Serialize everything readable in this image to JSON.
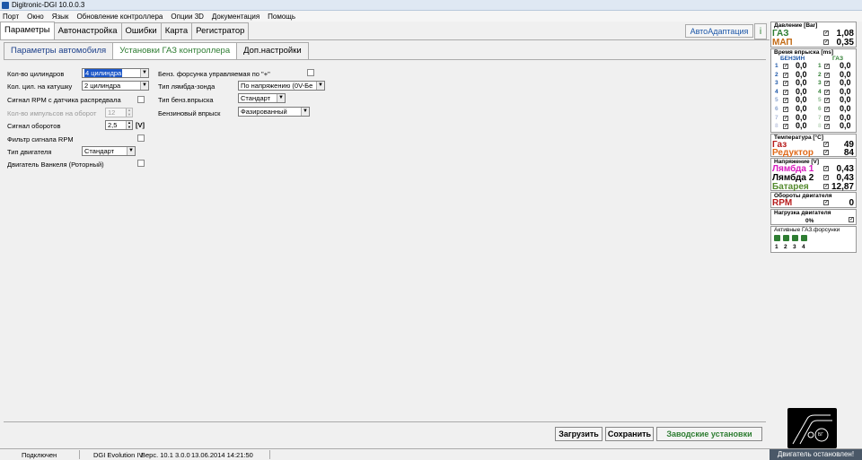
{
  "window": {
    "title": "Digitronic-DGI  10.0.0.3"
  },
  "menu": [
    "Порт",
    "Окно",
    "Язык",
    "Обновление контроллера",
    "Опции 3D",
    "Документация",
    "Помощь"
  ],
  "main_tabs": [
    "Параметры",
    "Автонастройка",
    "Ошибки",
    "Карта",
    "Регистратор"
  ],
  "auto_adapt": "АвтоАдаптация",
  "info_icon": "info-icon",
  "sub_tabs": [
    "Параметры автомобиля",
    "Установки ГАЗ контроллера",
    "Доп.настройки"
  ],
  "left_col": {
    "cyl_label": "Кол-во цилиндров",
    "cyl_value": "4 цилиндра",
    "coil_label": "Кол. цил. на катушку",
    "coil_value": "2 цилиндра",
    "rpm_sensor_label": "Сигнал RPM с датчика распредвала",
    "pulses_label": "Кол-во импульсов на оборот",
    "pulses_value": "12",
    "rpm_signal_label": "Сигнал оборотов",
    "rpm_signal_value": "2,5",
    "rpm_signal_unit": "[V]",
    "rpm_filter_label": "Фильтр сигнала RPM",
    "engine_type_label": "Тип двигателя",
    "engine_type_value": "Стандарт",
    "wankel_label": "Двигатель Ванкеля (Роторный)"
  },
  "mid_col": {
    "inj_ctrl_label": "Бенз. форсунка управляемая по \"+\"",
    "lambda_type_label": "Тип лямбда-зонда",
    "lambda_type_value": "По напряжению  (0V-Бе",
    "petrol_inj_type_label": "Тип бенз.впрыска",
    "petrol_inj_type_value": "Стандарт",
    "petrol_inj_label": "Бензиновый впрыск",
    "petrol_inj_value": "Фазированный"
  },
  "buttons": {
    "load": "Загрузить",
    "save": "Сохранить",
    "factory": "Заводские установки"
  },
  "status": {
    "connected": "Подключен",
    "device": "DGI Evolution IV",
    "version": "Верс.  10.1  3.0.0",
    "datetime": "13.06.2014 14:21:50",
    "engine_state": "Двигатель остановлен!"
  },
  "right_panel": {
    "pressure_title": "Давление [Bar]",
    "gas_label": "ГАЗ",
    "gas_value": "1,08",
    "map_label": "МАП",
    "map_value": "0,35",
    "inj_time_title": "Время впрыска [ms]",
    "petrol_col": "БЕНЗИН",
    "gas_col": "ГАЗ",
    "injectors": [
      {
        "n": "1",
        "p": "0,0",
        "g": "0,0"
      },
      {
        "n": "2",
        "p": "0,0",
        "g": "0,0"
      },
      {
        "n": "3",
        "p": "0,0",
        "g": "0,0"
      },
      {
        "n": "4",
        "p": "0,0",
        "g": "0,0"
      },
      {
        "n": "5",
        "p": "0,0",
        "g": "0,0"
      },
      {
        "n": "6",
        "p": "0,0",
        "g": "0,0"
      },
      {
        "n": "7",
        "p": "0,0",
        "g": "0,0"
      },
      {
        "n": "8",
        "p": "0,0",
        "g": "0,0"
      }
    ],
    "temp_title": "Температура  [°C]",
    "temp_gas_label": "Газ",
    "temp_gas_value": "49",
    "temp_red_label": "Редуктор",
    "temp_red_value": "84",
    "voltage_title": "Напряжение [V]",
    "lambda1_label": "Лямбда 1",
    "lambda1_value": "0,43",
    "lambda2_label": "Лямбда 2",
    "lambda2_value": "0,43",
    "battery_label": "Батарея",
    "battery_value": "12,87",
    "rpm_title": "Обороты двигателя",
    "rpm_label": "RPM",
    "rpm_value": "0",
    "load_title": "Нагрузка двигателя",
    "load_value": "0%",
    "active_inj_title": "Активные ГАЗ.форсунки",
    "active_inj": [
      "1",
      "2",
      "3",
      "4"
    ],
    "logo_text": "БГ"
  },
  "colors": {
    "accent": "#1b56a8",
    "gas_green": "#2e7d32",
    "lambda_pink": "#d81bbf",
    "map_orange": "#c26a14",
    "gas_red": "#b71c1c"
  }
}
